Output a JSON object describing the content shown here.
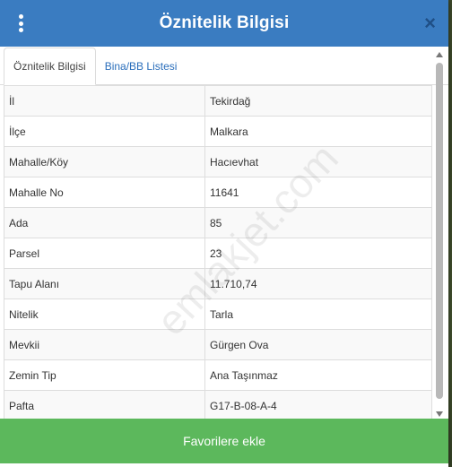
{
  "header": {
    "title": "Öznitelik Bilgisi",
    "close_label": "×"
  },
  "tabs": [
    {
      "label": "Öznitelik Bilgisi",
      "active": true
    },
    {
      "label": "Bina/BB Listesi",
      "active": false
    }
  ],
  "rows": [
    {
      "key": "İl",
      "value": "Tekirdağ"
    },
    {
      "key": "İlçe",
      "value": "Malkara"
    },
    {
      "key": "Mahalle/Köy",
      "value": "Hacıevhat"
    },
    {
      "key": "Mahalle No",
      "value": "11641"
    },
    {
      "key": "Ada",
      "value": "85"
    },
    {
      "key": "Parsel",
      "value": "23"
    },
    {
      "key": "Tapu Alanı",
      "value": "11.710,74"
    },
    {
      "key": "Nitelik",
      "value": "Tarla"
    },
    {
      "key": "Mevkii",
      "value": "Gürgen Ova"
    },
    {
      "key": "Zemin Tip",
      "value": "Ana Taşınmaz"
    },
    {
      "key": "Pafta",
      "value": "G17-B-08-A-4"
    }
  ],
  "watermark": "emlakjet.com",
  "footer": {
    "button_label": "Favorilere ekle"
  },
  "colors": {
    "header": "#3a7cc1",
    "footer": "#5cb85c",
    "tab_link": "#2a6ebb"
  }
}
